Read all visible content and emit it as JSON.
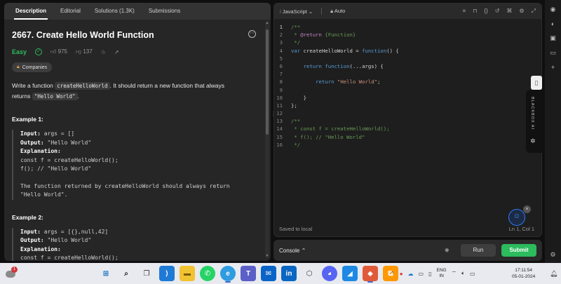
{
  "left_panel": {
    "tabs": [
      "Description",
      "Editorial",
      "Solutions (1.3K)",
      "Submissions"
    ],
    "title": "2667. Create Hello World Function",
    "difficulty": "Easy",
    "likes": "975",
    "dislikes": "137",
    "companies_label": "Companies",
    "desc_part1": "Write a function ",
    "desc_code1": "createHelloWorld",
    "desc_part2": ". It should return a new function that always returns ",
    "desc_code2": "\"Hello World\"",
    "desc_part3": ".",
    "example1": {
      "title": "Example 1:",
      "input_label": "Input:",
      "input_value": " args = []",
      "output_label": "Output:",
      "output_value": " \"Hello World\"",
      "explanation_label": "Explanation:",
      "line1": "const f = createHelloWorld();",
      "line2": "f(); // \"Hello World\"",
      "note1": "The function returned by createHelloWorld should always return",
      "note2": "\"Hello World\"."
    },
    "example2": {
      "title": "Example 2:",
      "input_label": "Input:",
      "input_value": " args = [{},null,42]",
      "output_label": "Output:",
      "output_value": " \"Hello World\"",
      "explanation_label": "Explanation:",
      "line1": "const f = createHelloWorld();"
    }
  },
  "editor": {
    "language": "JavaScript",
    "auto_label": "Auto",
    "saved_status": "Saved to local",
    "cursor_position": "Ln 1, Col 1",
    "code_lines": [
      {
        "n": "1",
        "parts": [
          [
            "c",
            "/**"
          ]
        ]
      },
      {
        "n": "2",
        "parts": [
          [
            "c",
            " * "
          ],
          [
            "ann",
            "@return"
          ],
          [
            "c",
            " {Function}"
          ]
        ]
      },
      {
        "n": "3",
        "parts": [
          [
            "c",
            " */"
          ]
        ]
      },
      {
        "n": "4",
        "parts": [
          [
            "kw",
            "var"
          ],
          [
            "v",
            " createHelloWorld = "
          ],
          [
            "kw",
            "function"
          ],
          [
            "v",
            "() {"
          ]
        ]
      },
      {
        "n": "5",
        "parts": []
      },
      {
        "n": "6",
        "parts": [
          [
            "v",
            "    "
          ],
          [
            "kw",
            "return"
          ],
          [
            "v",
            " "
          ],
          [
            "kw",
            "function"
          ],
          [
            "v",
            "(...args) {"
          ]
        ]
      },
      {
        "n": "7",
        "parts": []
      },
      {
        "n": "8",
        "parts": [
          [
            "v",
            "        "
          ],
          [
            "kw",
            "return"
          ],
          [
            "v",
            " "
          ],
          [
            "str",
            "\"Hello World\""
          ],
          [
            "v",
            ";"
          ]
        ]
      },
      {
        "n": "9",
        "parts": []
      },
      {
        "n": "10",
        "parts": [
          [
            "v",
            "    }"
          ]
        ]
      },
      {
        "n": "11",
        "parts": [
          [
            "v",
            "};"
          ]
        ]
      },
      {
        "n": "12",
        "parts": []
      },
      {
        "n": "13",
        "parts": [
          [
            "c",
            "/**"
          ]
        ]
      },
      {
        "n": "14",
        "parts": [
          [
            "c",
            " * const f = createHelloWorld();"
          ]
        ]
      },
      {
        "n": "15",
        "parts": [
          [
            "c",
            " * f(); // \"Hello World\""
          ]
        ]
      },
      {
        "n": "16",
        "parts": [
          [
            "c",
            " */"
          ]
        ]
      }
    ]
  },
  "console": {
    "label": "Console",
    "run_label": "Run",
    "submit_label": "Submit"
  },
  "blackbox": {
    "label": "BLACKBOX AI"
  },
  "taskbar": {
    "weather_badge": "1",
    "lang_line1": "ENG",
    "lang_line2": "IN",
    "time": "17:11:54",
    "date": "05-01-2024"
  }
}
